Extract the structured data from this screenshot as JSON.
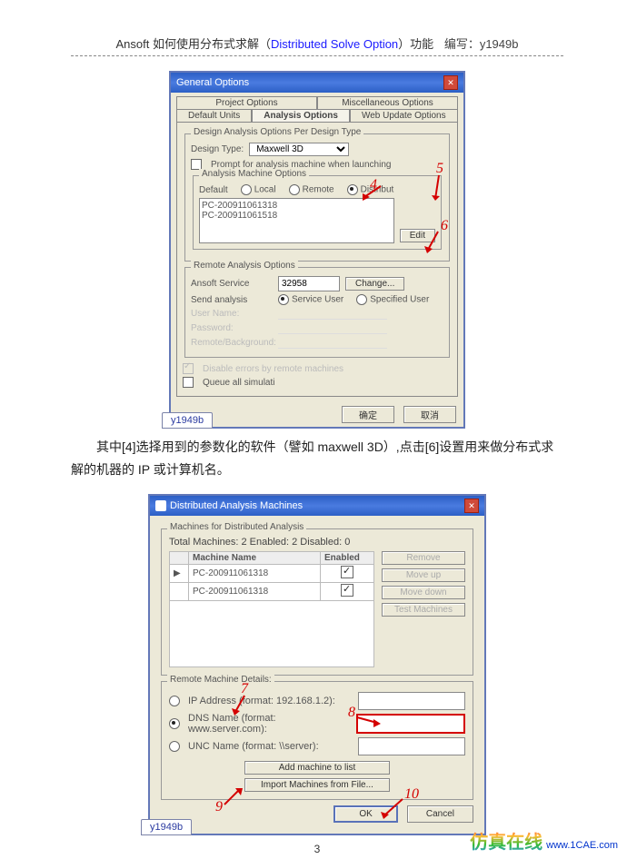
{
  "header": {
    "prefix": "Ansoft 如何使用分布式求解（",
    "dso": "Distributed Solve Option",
    "suffix": "）功能",
    "author": "编写：y1949b"
  },
  "d1": {
    "title": "General Options",
    "tabsRow1": {
      "a": "Project Options",
      "b": "Miscellaneous Options"
    },
    "tabsRow2": {
      "a": "Default Units",
      "b": "Analysis Options",
      "c": "Web Update Options"
    },
    "grp1Title": "Design Analysis Options Per Design Type",
    "designTypeLabel": "Design Type:",
    "designType": "Maxwell 3D",
    "prompt": "Prompt for analysis machine when launching",
    "amoTitle": "Analysis Machine Options",
    "default": "Default",
    "local": "Local",
    "remote": "Remote",
    "distribut": "Distribut",
    "machines": [
      "PC-200911061318",
      "PC-200911061518"
    ],
    "editBtn": "Edit",
    "raoTitle": "Remote Analysis Options",
    "ansoftSvc": "Ansoft Service",
    "port": "32958",
    "changeBtn": "Change...",
    "sendAnalysis": "Send analysis",
    "svcUser": "Service User",
    "specUser": "Specified User",
    "userName": "User Name:",
    "password": "Password:",
    "foreback": "Remote/Background:",
    "disableErrors": "Disable errors by remote machines",
    "queue": "Queue all simulati",
    "ok": "确定",
    "cancel": "取消",
    "wm": "y1949b"
  },
  "para": "其中[4]选择用到的参数化的软件（譬如 maxwell 3D）,点击[6]设置用来做分布式求解的机器的 IP 或计算机名。",
  "d2": {
    "title": "Distributed Analysis Machines",
    "heading": "Machines for Distributed Analysis",
    "totals": "Total Machines: 2  Enabled: 2  Disabled: 0",
    "colName": "Machine Name",
    "colEnabled": "Enabled",
    "rows": [
      {
        "name": "PC-200911061318",
        "en": true
      },
      {
        "name": "PC-200911061318",
        "en": true
      }
    ],
    "btnRemove": "Remove",
    "btnUp": "Move up",
    "btnDown": "Move down",
    "btnTest": "Test Machines",
    "rmdTitle": "Remote Machine Details:",
    "ip": "IP Address (format: 192.168.1.2):",
    "dns": "DNS Name (format: www.server.com):",
    "unc": "UNC Name (format: \\\\server):",
    "addBtn": "Add machine to list",
    "importBtn": "Import Machines from File...",
    "ok": "OK",
    "cancel": "Cancel",
    "wm": "y1949b"
  },
  "callouts": {
    "c4": "4",
    "c5": "5",
    "c6": "6",
    "c7": "7",
    "c8": "8",
    "c9": "9",
    "c10": "10"
  },
  "pageNo": "3",
  "footer": {
    "cn": "仿真在线",
    "url": "www.1CAE.com"
  }
}
